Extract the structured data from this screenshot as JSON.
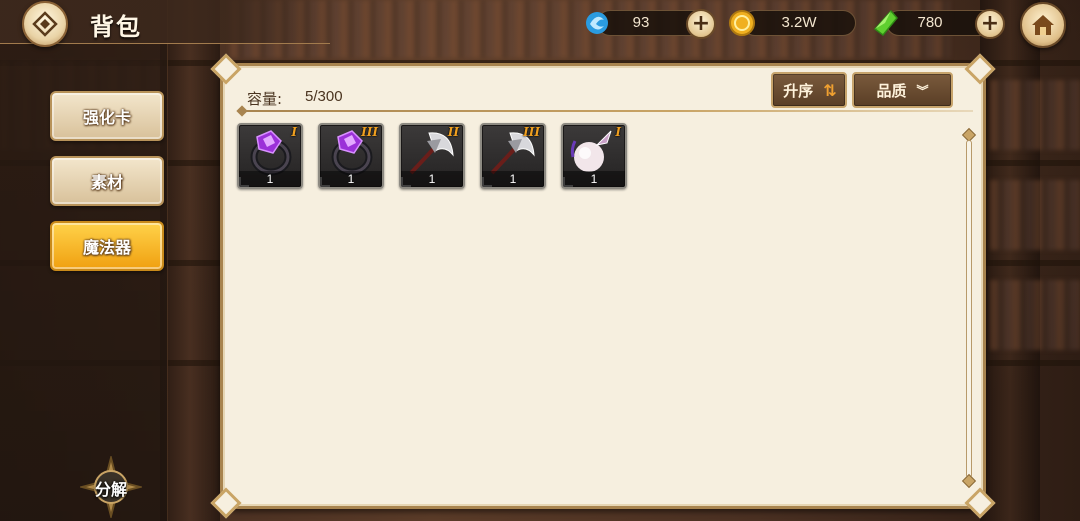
{
  "header": {
    "title": "背包",
    "back_icon": "diamond-back-icon",
    "home_icon": "home-icon"
  },
  "currencies": [
    {
      "name": "blue-fish",
      "icon": "blue-orb-icon",
      "value": "93",
      "has_plus": true
    },
    {
      "name": "gold",
      "icon": "gold-coin-icon",
      "value": "3.2W",
      "has_plus": false
    },
    {
      "name": "green-gem",
      "icon": "green-gem-icon",
      "value": "780",
      "has_plus": true
    }
  ],
  "sidebar": {
    "tabs": [
      {
        "label": "强化卡",
        "active": false
      },
      {
        "label": "素材",
        "active": false
      },
      {
        "label": "魔法器",
        "active": true
      }
    ],
    "decompose_label": "分解"
  },
  "panel": {
    "capacity_label": "容量:",
    "capacity_value": "5/300",
    "sort_label": "升序",
    "sort_icon": "sort-arrows-icon",
    "filter_label": "品质",
    "filter_icon": "chevron-down-icon"
  },
  "items": [
    {
      "type": "purple-ring",
      "tier": "I",
      "count": "1"
    },
    {
      "type": "purple-ring",
      "tier": "III",
      "count": "1"
    },
    {
      "type": "axe",
      "tier": "II",
      "count": "1"
    },
    {
      "type": "axe",
      "tier": "III",
      "count": "1"
    },
    {
      "type": "pearl-pendant",
      "tier": "I",
      "count": "1"
    }
  ],
  "colors": {
    "active_tab": "#f0a010",
    "panel_bg": "#f6efdf",
    "tier_text": "#f0a020"
  }
}
